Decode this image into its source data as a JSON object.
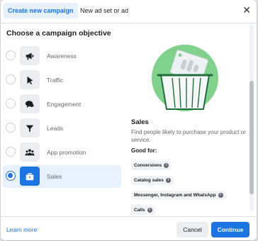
{
  "tabs": {
    "active_label": "Create new campaign",
    "secondary_label": "New ad set or ad",
    "close_icon": "close-icon"
  },
  "heading": "Choose a campaign objective",
  "options": [
    {
      "label": "Awareness",
      "icon": "megaphone-icon",
      "selected": false
    },
    {
      "label": "Traffic",
      "icon": "cursor-icon",
      "selected": false
    },
    {
      "label": "Engagement",
      "icon": "speech-bubbles-icon",
      "selected": false
    },
    {
      "label": "Leads",
      "icon": "funnel-icon",
      "selected": false
    },
    {
      "label": "App promotion",
      "icon": "people-icon",
      "selected": false
    },
    {
      "label": "Sales",
      "icon": "briefcase-icon",
      "selected": true
    }
  ],
  "detail": {
    "title": "Sales",
    "description": "Find people likely to purchase your product or service.",
    "good_for_label": "Good for:",
    "chips": [
      "Conversions",
      "Catalog sales",
      "Messenger, Instagram and WhatsApp",
      "Calls"
    ],
    "illustration": "shopping-basket-price-tag-illustration"
  },
  "footer": {
    "learn_more": "Learn more",
    "cancel": "Cancel",
    "continue": "Continue"
  },
  "colors": {
    "accent": "#1b74e4",
    "accent_bg": "#e7f0fd",
    "illustration_green": "#7fd18b"
  }
}
